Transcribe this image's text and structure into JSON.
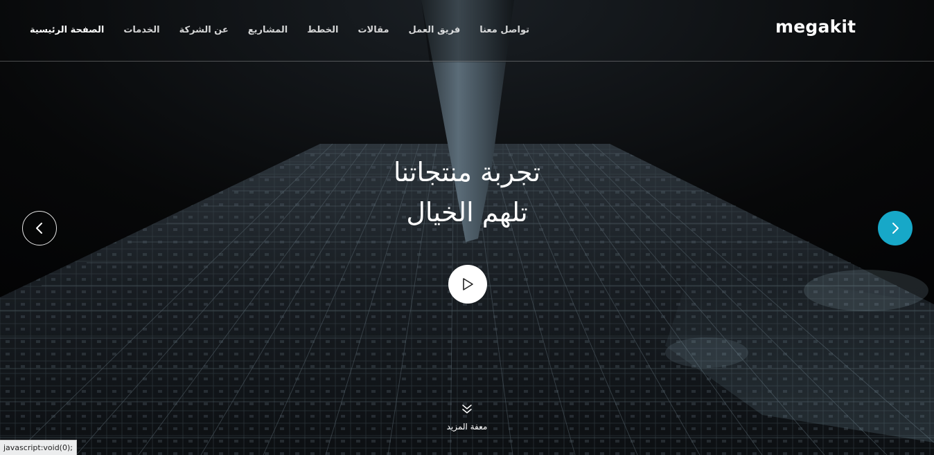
{
  "brand": {
    "logo_text": "megakit"
  },
  "nav": {
    "items": [
      {
        "label": "الصفحة الرئيسية",
        "active": true
      },
      {
        "label": "الخدمات",
        "active": false
      },
      {
        "label": "عن الشركة",
        "active": false
      },
      {
        "label": "المشاريع",
        "active": false
      },
      {
        "label": "الخطط",
        "active": false
      },
      {
        "label": "مقالات",
        "active": false
      },
      {
        "label": "فريق العمل",
        "active": false
      },
      {
        "label": "تواصل معنا",
        "active": false
      }
    ]
  },
  "hero": {
    "headline_line1": "تجربة منتجاتنا",
    "headline_line2": "تلهم الخيال",
    "play_icon": "play-icon",
    "prev_icon": "chevron-left-icon",
    "next_icon": "chevron-right-icon",
    "scroll_icon": "double-chevron-down-icon",
    "more_label": "معفة المزيد",
    "accent_color": "#17a8c8"
  },
  "status_bar": {
    "text": "javascript:void(0);"
  }
}
